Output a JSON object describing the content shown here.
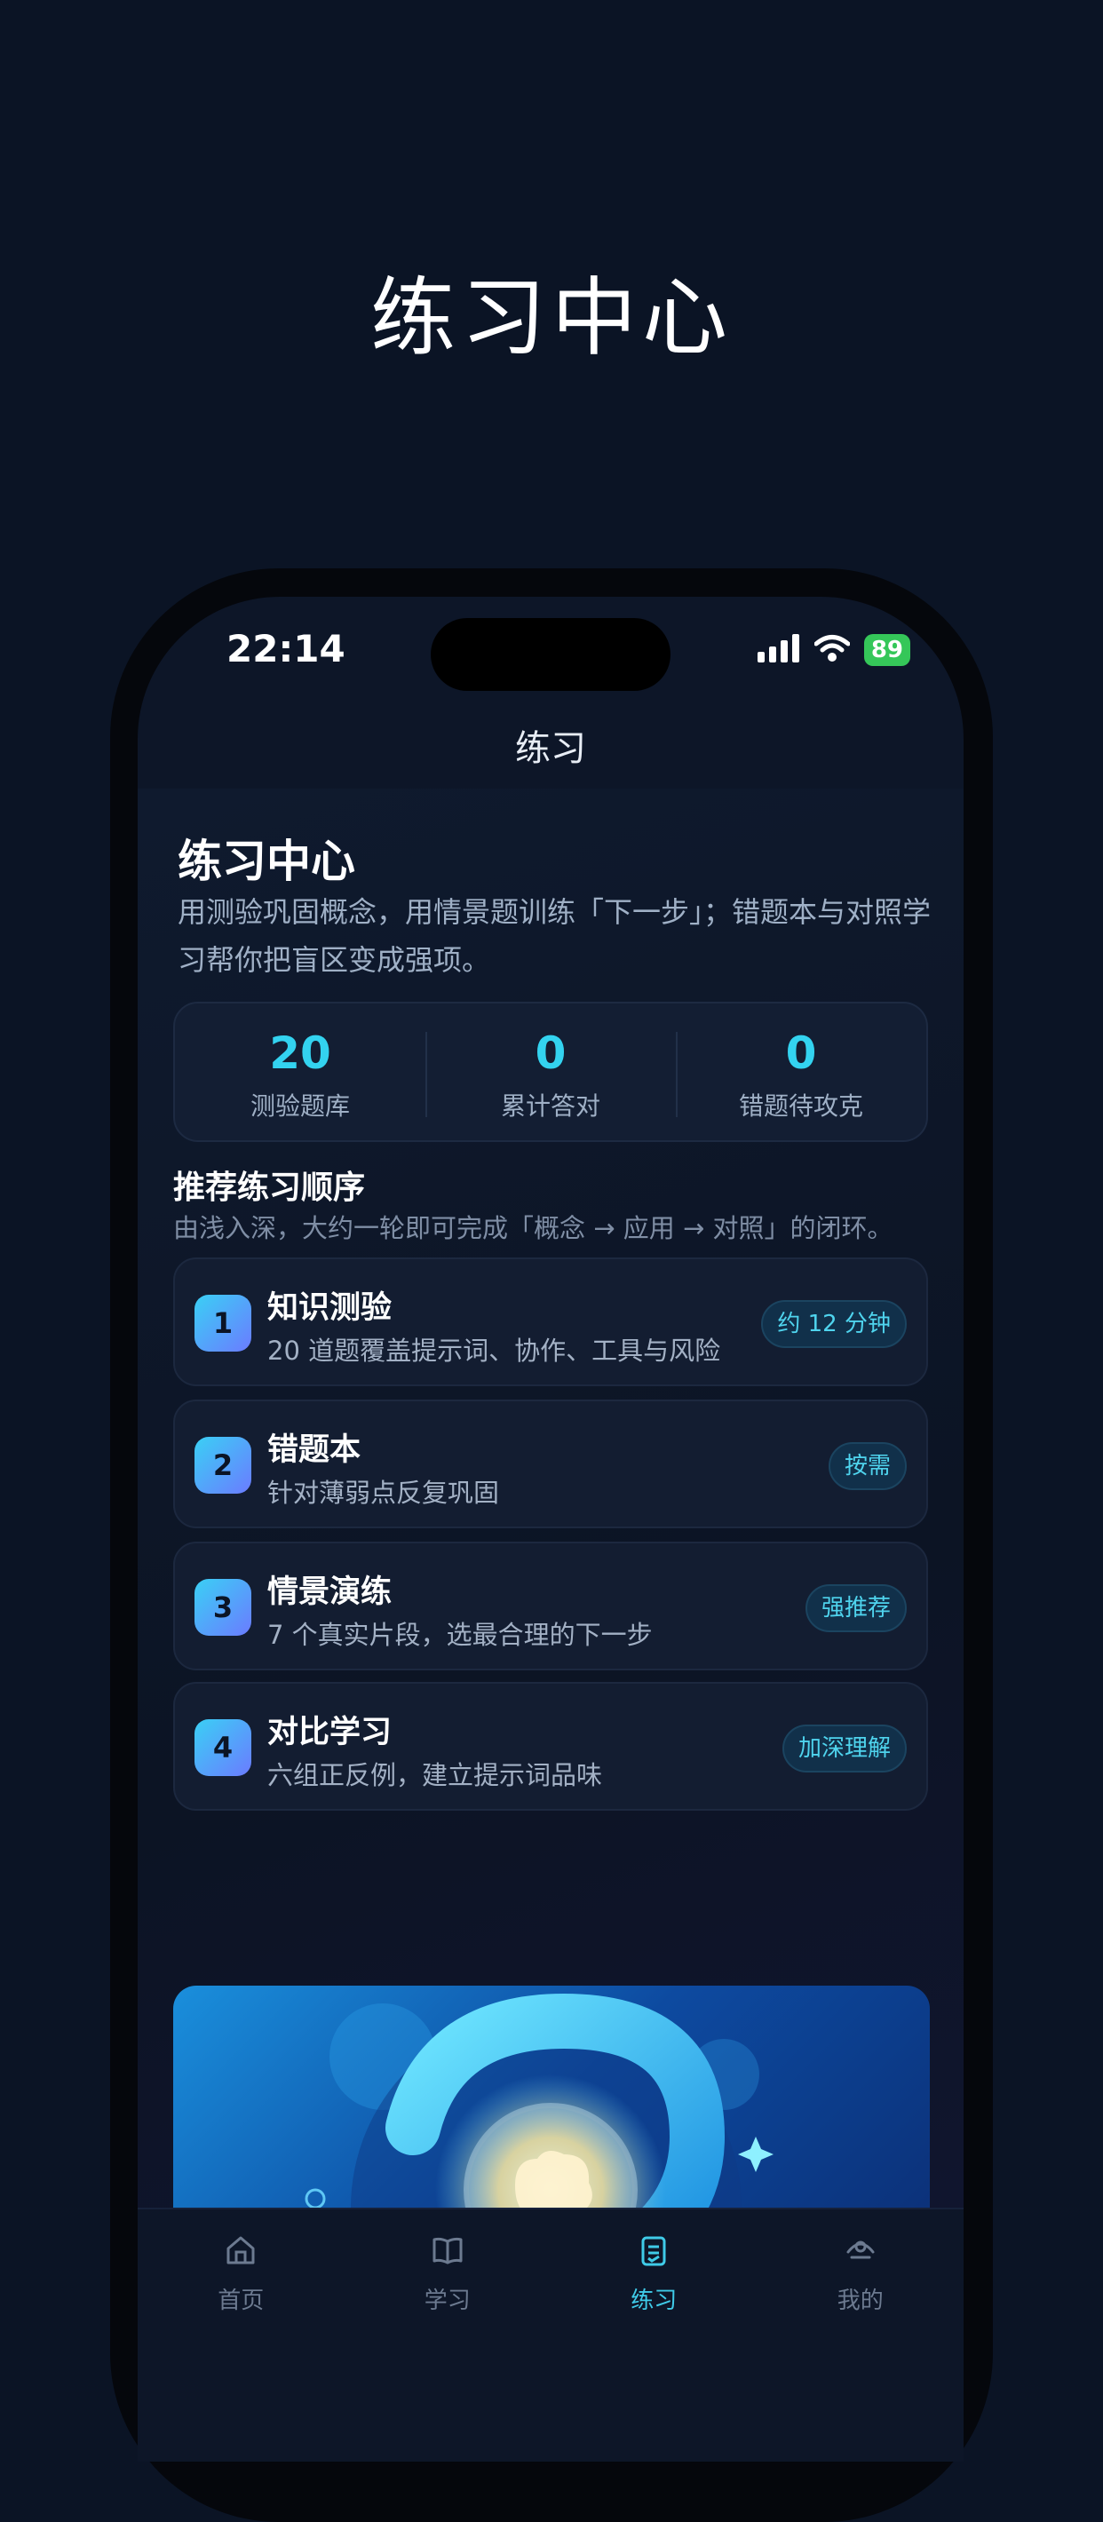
{
  "headline": "练习中心",
  "status": {
    "time": "22:14",
    "battery": "89"
  },
  "nav": {
    "title": "练习"
  },
  "hero": {
    "title": "练习中心",
    "description": "用测验巩固概念，用情景题训练「下一步」；错题本与对照学习帮你把盲区变成强项。"
  },
  "stats": [
    {
      "value": "20",
      "label": "测验题库"
    },
    {
      "value": "0",
      "label": "累计答对"
    },
    {
      "value": "0",
      "label": "错题待攻克"
    }
  ],
  "section": {
    "title": "推荐练习顺序",
    "subtitle": "由浅入深，大约一轮即可完成「概念 → 应用 → 对照」的闭环。"
  },
  "steps": [
    {
      "num": "1",
      "title": "知识测验",
      "subtitle": "20 道题覆盖提示词、协作、工具与风险",
      "tag": "约 12 分钟"
    },
    {
      "num": "2",
      "title": "错题本",
      "subtitle": "针对薄弱点反复巩固",
      "tag": "按需"
    },
    {
      "num": "3",
      "title": "情景演练",
      "subtitle": "7 个真实片段，选最合理的下一步",
      "tag": "强推荐"
    },
    {
      "num": "4",
      "title": "对比学习",
      "subtitle": "六组正反例，建立提示词品味",
      "tag": "加深理解"
    }
  ],
  "tabs": [
    {
      "label": "首页",
      "icon": "home-icon"
    },
    {
      "label": "学习",
      "icon": "book-icon"
    },
    {
      "label": "练习",
      "icon": "clipboard-icon",
      "active": true
    },
    {
      "label": "我的",
      "icon": "user-icon"
    }
  ],
  "colors": {
    "accent": "#33d3f0",
    "background": "#0b1425",
    "battery": "#35c759"
  }
}
